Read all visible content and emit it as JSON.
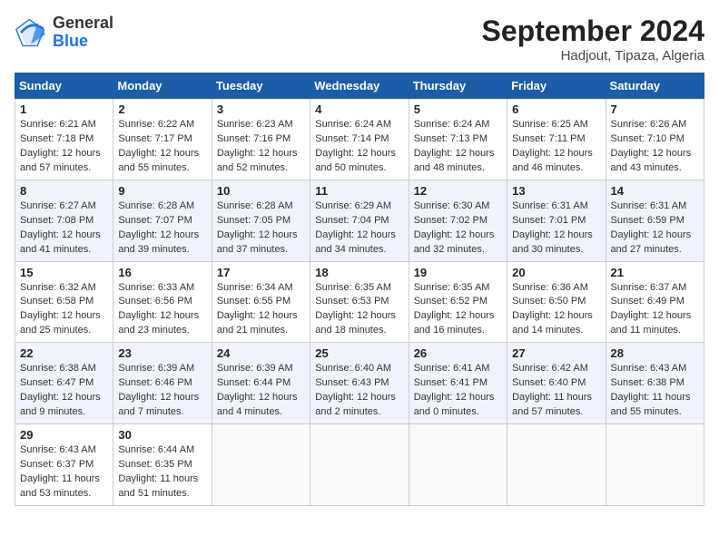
{
  "header": {
    "logo_line1": "General",
    "logo_line2": "Blue",
    "month_year": "September 2024",
    "location": "Hadjout, Tipaza, Algeria"
  },
  "weekdays": [
    "Sunday",
    "Monday",
    "Tuesday",
    "Wednesday",
    "Thursday",
    "Friday",
    "Saturday"
  ],
  "weeks": [
    [
      {
        "day": "1",
        "sunrise": "6:21 AM",
        "sunset": "7:18 PM",
        "daylight": "12 hours and 57 minutes."
      },
      {
        "day": "2",
        "sunrise": "6:22 AM",
        "sunset": "7:17 PM",
        "daylight": "12 hours and 55 minutes."
      },
      {
        "day": "3",
        "sunrise": "6:23 AM",
        "sunset": "7:16 PM",
        "daylight": "12 hours and 52 minutes."
      },
      {
        "day": "4",
        "sunrise": "6:24 AM",
        "sunset": "7:14 PM",
        "daylight": "12 hours and 50 minutes."
      },
      {
        "day": "5",
        "sunrise": "6:24 AM",
        "sunset": "7:13 PM",
        "daylight": "12 hours and 48 minutes."
      },
      {
        "day": "6",
        "sunrise": "6:25 AM",
        "sunset": "7:11 PM",
        "daylight": "12 hours and 46 minutes."
      },
      {
        "day": "7",
        "sunrise": "6:26 AM",
        "sunset": "7:10 PM",
        "daylight": "12 hours and 43 minutes."
      }
    ],
    [
      {
        "day": "8",
        "sunrise": "6:27 AM",
        "sunset": "7:08 PM",
        "daylight": "12 hours and 41 minutes."
      },
      {
        "day": "9",
        "sunrise": "6:28 AM",
        "sunset": "7:07 PM",
        "daylight": "12 hours and 39 minutes."
      },
      {
        "day": "10",
        "sunrise": "6:28 AM",
        "sunset": "7:05 PM",
        "daylight": "12 hours and 37 minutes."
      },
      {
        "day": "11",
        "sunrise": "6:29 AM",
        "sunset": "7:04 PM",
        "daylight": "12 hours and 34 minutes."
      },
      {
        "day": "12",
        "sunrise": "6:30 AM",
        "sunset": "7:02 PM",
        "daylight": "12 hours and 32 minutes."
      },
      {
        "day": "13",
        "sunrise": "6:31 AM",
        "sunset": "7:01 PM",
        "daylight": "12 hours and 30 minutes."
      },
      {
        "day": "14",
        "sunrise": "6:31 AM",
        "sunset": "6:59 PM",
        "daylight": "12 hours and 27 minutes."
      }
    ],
    [
      {
        "day": "15",
        "sunrise": "6:32 AM",
        "sunset": "6:58 PM",
        "daylight": "12 hours and 25 minutes."
      },
      {
        "day": "16",
        "sunrise": "6:33 AM",
        "sunset": "6:56 PM",
        "daylight": "12 hours and 23 minutes."
      },
      {
        "day": "17",
        "sunrise": "6:34 AM",
        "sunset": "6:55 PM",
        "daylight": "12 hours and 21 minutes."
      },
      {
        "day": "18",
        "sunrise": "6:35 AM",
        "sunset": "6:53 PM",
        "daylight": "12 hours and 18 minutes."
      },
      {
        "day": "19",
        "sunrise": "6:35 AM",
        "sunset": "6:52 PM",
        "daylight": "12 hours and 16 minutes."
      },
      {
        "day": "20",
        "sunrise": "6:36 AM",
        "sunset": "6:50 PM",
        "daylight": "12 hours and 14 minutes."
      },
      {
        "day": "21",
        "sunrise": "6:37 AM",
        "sunset": "6:49 PM",
        "daylight": "12 hours and 11 minutes."
      }
    ],
    [
      {
        "day": "22",
        "sunrise": "6:38 AM",
        "sunset": "6:47 PM",
        "daylight": "12 hours and 9 minutes."
      },
      {
        "day": "23",
        "sunrise": "6:39 AM",
        "sunset": "6:46 PM",
        "daylight": "12 hours and 7 minutes."
      },
      {
        "day": "24",
        "sunrise": "6:39 AM",
        "sunset": "6:44 PM",
        "daylight": "12 hours and 4 minutes."
      },
      {
        "day": "25",
        "sunrise": "6:40 AM",
        "sunset": "6:43 PM",
        "daylight": "12 hours and 2 minutes."
      },
      {
        "day": "26",
        "sunrise": "6:41 AM",
        "sunset": "6:41 PM",
        "daylight": "12 hours and 0 minutes."
      },
      {
        "day": "27",
        "sunrise": "6:42 AM",
        "sunset": "6:40 PM",
        "daylight": "11 hours and 57 minutes."
      },
      {
        "day": "28",
        "sunrise": "6:43 AM",
        "sunset": "6:38 PM",
        "daylight": "11 hours and 55 minutes."
      }
    ],
    [
      {
        "day": "29",
        "sunrise": "6:43 AM",
        "sunset": "6:37 PM",
        "daylight": "11 hours and 53 minutes."
      },
      {
        "day": "30",
        "sunrise": "6:44 AM",
        "sunset": "6:35 PM",
        "daylight": "11 hours and 51 minutes."
      },
      null,
      null,
      null,
      null,
      null
    ]
  ]
}
